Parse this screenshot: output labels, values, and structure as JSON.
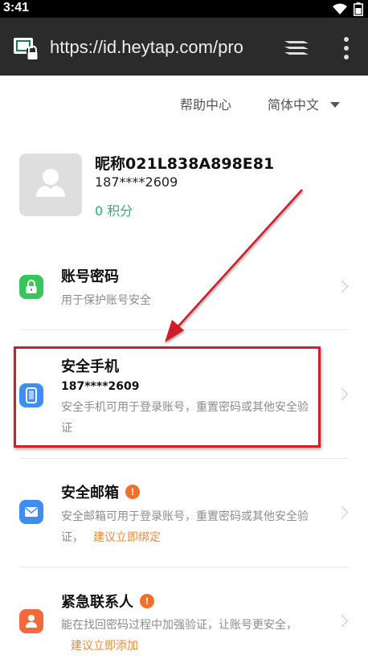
{
  "status_bar": {
    "time": "3:41"
  },
  "browser": {
    "url": "https://id.heytap.com/pro"
  },
  "header": {
    "help_label": "帮助中心",
    "language_label": "简体中文"
  },
  "profile": {
    "nickname": "昵称021L838A898E81",
    "phone": "187****2609",
    "points": "0 积分"
  },
  "security_items": [
    {
      "title": "账号密码",
      "description": "用于保护账号安全",
      "icon": "lock-icon",
      "color": "#37c65a"
    },
    {
      "title": "安全手机",
      "value": "187****2609",
      "description": "安全手机可用于登录账号，重置密码或其他安全验证",
      "icon": "phone-icon",
      "color": "#3d8df2"
    },
    {
      "title": "安全邮箱",
      "description": "安全邮箱可用于登录账号，重置密码或其他安全验证，",
      "action": "建议立即绑定",
      "icon": "mail-icon",
      "color": "#3d8df2"
    },
    {
      "title": "紧急联系人",
      "description": "能在找回密码过程中加强验证，让账号更安全，",
      "action": "建议立即添加",
      "icon": "contact-icon",
      "color": "#f26a3c"
    }
  ],
  "colors": {
    "accent_green": "#22b573",
    "action_orange": "#f08a3a",
    "annotation_red": "#d11f2a"
  }
}
